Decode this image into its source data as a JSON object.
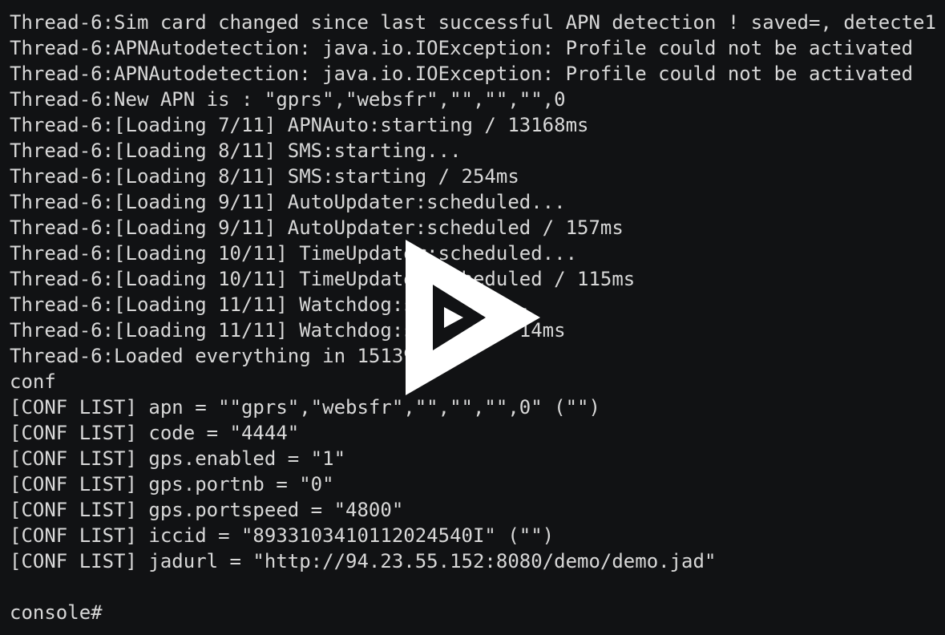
{
  "terminal": {
    "lines": [
      "Thread-6:Sim card changed since last successful APN detection ! saved=, detecte1",
      "Thread-6:APNAutodetection: java.io.IOException: Profile could not be activated",
      "Thread-6:APNAutodetection: java.io.IOException: Profile could not be activated",
      "Thread-6:New APN is : \"gprs\",\"websfr\",\"\",\"\",\"\",0",
      "Thread-6:[Loading 7/11] APNAuto:starting / 13168ms",
      "Thread-6:[Loading 8/11] SMS:starting...",
      "Thread-6:[Loading 8/11] SMS:starting / 254ms",
      "Thread-6:[Loading 9/11] AutoUpdater:scheduled...",
      "Thread-6:[Loading 9/11] AutoUpdater:scheduled / 157ms",
      "Thread-6:[Loading 10/11] TimeUpdater:scheduled...",
      "Thread-6:[Loading 10/11] TimeUpdater:scheduled / 115ms",
      "Thread-6:[Loading 11/11] Watchdog:starting...",
      "Thread-6:[Loading 11/11] Watchdog:started / 14ms",
      "Thread-6:Loaded everything in 15139ms",
      "conf",
      "[CONF LIST] apn = \"\"gprs\",\"websfr\",\"\",\"\",\"\",0\" (\"\")",
      "[CONF LIST] code = \"4444\"",
      "[CONF LIST] gps.enabled = \"1\"",
      "[CONF LIST] gps.portnb = \"0\"",
      "[CONF LIST] gps.portspeed = \"4800\"",
      "[CONF LIST] iccid = \"8933103410112024540I\" (\"\")",
      "[CONF LIST] jadurl = \"http://94.23.55.152:8080/demo/demo.jad\"",
      ""
    ],
    "prompt": "console#"
  },
  "overlay": {
    "icon": "play-icon",
    "color": "#ffffff"
  },
  "colors": {
    "background": "#111214",
    "text": "#d8d8d8"
  }
}
